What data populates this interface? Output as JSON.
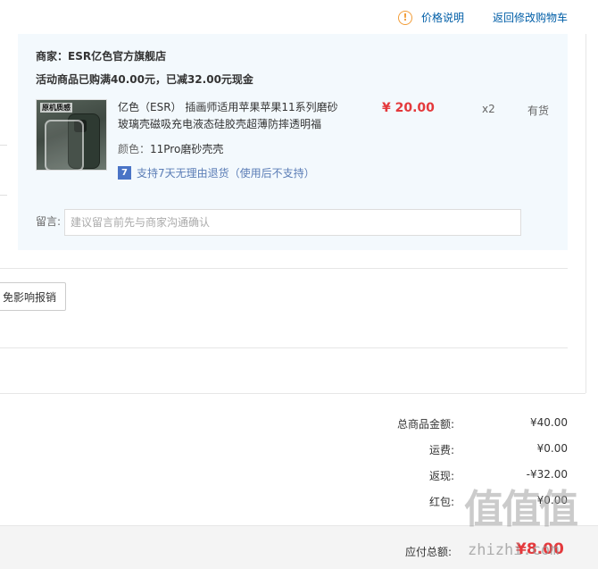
{
  "header": {
    "price_note": "价格说明",
    "back_to_cart": "返回修改购物车"
  },
  "shop": {
    "name": "商家：ESR亿色官方旗舰店",
    "promo": "活动商品已购满40.00元，已减32.00元现金"
  },
  "item": {
    "image_label": "原机质感",
    "title": "亿色（ESR） 插画师适用苹果苹果11系列磨砂玻璃壳磁吸充电液态硅胶壳超薄防摔透明福",
    "color_label": "颜色：",
    "color_value": "11Pro磨砂壳壳",
    "return_badge": "7",
    "return_policy": "支持7天无理由退货（使用后不支持）",
    "price": "¥ 20.00",
    "quantity": "x2",
    "stock": "有货"
  },
  "message": {
    "label": "留言:",
    "placeholder": "建议留言前先与商家沟通确认"
  },
  "partial_button": "免影响报销",
  "summary": {
    "rows": [
      {
        "label": "总商品金额:",
        "value": "¥40.00"
      },
      {
        "label": "运费:",
        "value": "¥0.00"
      },
      {
        "label": "返现:",
        "value": "-¥32.00"
      },
      {
        "label": "红包:",
        "value": "¥0.00"
      }
    ],
    "total_label": "应付总额:",
    "total_value": "¥8.00"
  },
  "watermark": {
    "glyphs": "值值值",
    "url": "zhizhi.com"
  },
  "colors": {
    "link": "#005ea7",
    "price_red": "#e4393c",
    "panel_bg": "#f3f9fd",
    "warning": "#f29d38"
  }
}
